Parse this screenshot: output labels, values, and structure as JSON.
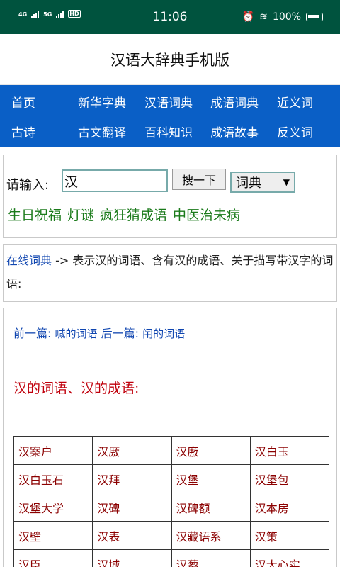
{
  "status": {
    "signal1": "4G",
    "signal2": "5G",
    "hd": "HD",
    "time": "11:06",
    "battery": "100%"
  },
  "app_title": "汉语大辞典手机版",
  "nav": {
    "row1": [
      "首页",
      "新华字典",
      "汉语词典",
      "成语词典",
      "近义词"
    ],
    "row2": [
      "古诗",
      "古文翻译",
      "百科知识",
      "成语故事",
      "反义词"
    ]
  },
  "search": {
    "label": "请输入:",
    "value": "汉",
    "button": "搜一下",
    "select": "词典",
    "quick_links": [
      "生日祝福",
      "灯谜",
      "疯狂猜成语",
      "中医治未病"
    ]
  },
  "info": {
    "link": "在线词典",
    "text": " -> 表示汉的词语、含有汉的成语、关于描写带汉字的词语:"
  },
  "content": {
    "prev_label": "前一篇:",
    "prev_link": "喊的词语",
    "next_label": "后一篇:",
    "next_link": "闬的词语",
    "section_title": "汉的词语、汉的成语:",
    "words": [
      [
        "汉案户",
        "汉厫",
        "汉廒",
        "汉白玉"
      ],
      [
        "汉白玉石",
        "汉拜",
        "汉堡",
        "汉堡包"
      ],
      [
        "汉堡大学",
        "汉碑",
        "汉碑额",
        "汉本房"
      ],
      [
        "汉壁",
        "汉表",
        "汉藏语系",
        "汉策"
      ],
      [
        "汉臣",
        "汉城",
        "汉蒭",
        "汉大心实"
      ]
    ]
  }
}
